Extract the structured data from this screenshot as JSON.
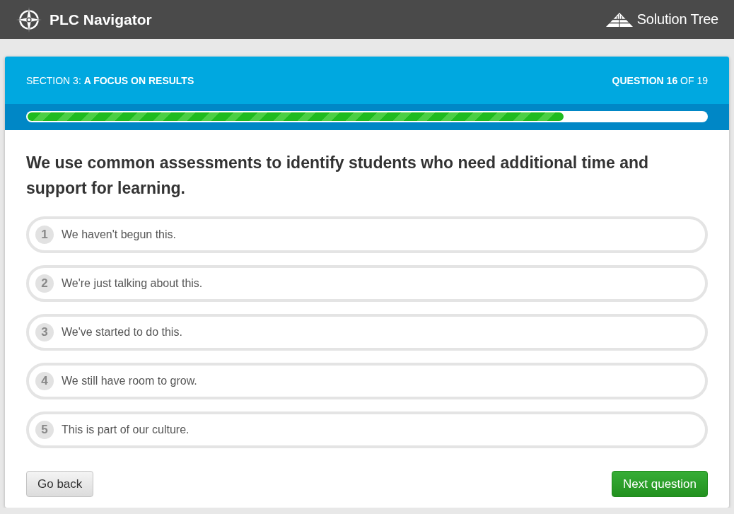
{
  "header": {
    "app_name": "PLC Navigator",
    "brand": "Solution Tree"
  },
  "quiz": {
    "section": "SECTION 3: **A FOCUS ON RESULTS**",
    "counter": "**QUESTION 16** OF 19",
    "progress": {
      "level": 0.79
    },
    "question": "We use common assessments to identify students who need additional time and support for learning.",
    "options": [
      {
        "number": "1",
        "label": "We haven't begun this.",
        "selected": false
      },
      {
        "number": "2",
        "label": "We're just talking about this.",
        "selected": false
      },
      {
        "number": "3",
        "label": "We've started to do this.",
        "selected": false
      },
      {
        "number": "4",
        "label": "We still have room to grow.",
        "selected": false
      },
      {
        "number": "5",
        "label": "This is part of our culture.",
        "selected": false
      }
    ],
    "buttons": [
      {
        "label": "Go back",
        "kind": "secondary"
      },
      {
        "label": "Next question",
        "kind": "primary"
      }
    ]
  }
}
